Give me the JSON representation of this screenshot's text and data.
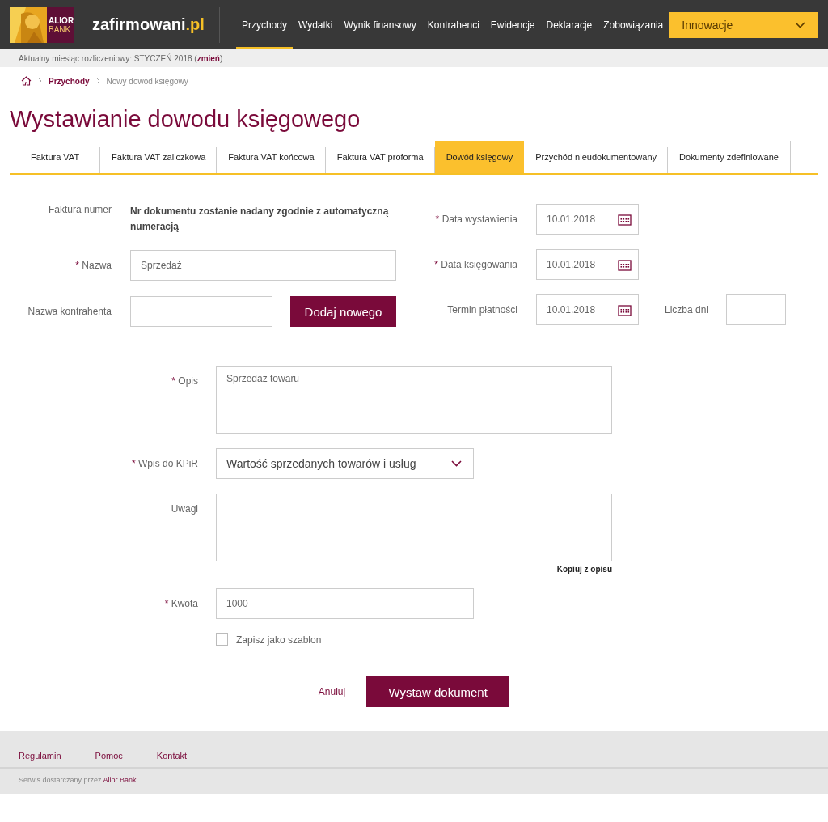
{
  "header": {
    "logo": {
      "line1": "ALIOR",
      "line2": "BANK"
    },
    "brand": {
      "name": "zafirmowani",
      "suffix": ".pl"
    },
    "nav": [
      {
        "label": "Przychody",
        "selected": true
      },
      {
        "label": "Wydatki",
        "selected": false
      },
      {
        "label": "Wynik finansowy",
        "selected": false
      },
      {
        "label": "Kontrahenci",
        "selected": false
      },
      {
        "label": "Ewidencje",
        "selected": false
      },
      {
        "label": "Deklaracje",
        "selected": false
      },
      {
        "label": "Zobowiązania",
        "selected": false
      }
    ],
    "dropdown": "Innowacje"
  },
  "period_bar": {
    "prefix": "Aktualny miesiąc rozliczeniowy: STYCZEŃ 2018 (",
    "link": "zmień",
    "suffix": ")"
  },
  "breadcrumb": [
    {
      "label": "Przychody",
      "kind": "link"
    },
    {
      "label": "Nowy dowód księgowy",
      "kind": "current"
    }
  ],
  "title": "Wystawianie dowodu księgowego",
  "tabs": [
    {
      "label": "Faktura VAT",
      "selected": false
    },
    {
      "label": "Faktura VAT zaliczkowa",
      "selected": false
    },
    {
      "label": "Faktura VAT końcowa",
      "selected": false
    },
    {
      "label": "Faktura VAT proforma",
      "selected": false
    },
    {
      "label": "Dowód księgowy",
      "selected": true
    },
    {
      "label": "Przychód nieudokumentowany",
      "selected": false
    },
    {
      "label": "Dokumenty zdefiniowane",
      "selected": false
    }
  ],
  "left_fields": [
    {
      "label": "Faktura numer",
      "kind": "info",
      "value": "Nr dokumentu zostanie nadany zgodnie z automatyczną numeracją"
    },
    {
      "label": "Nazwa",
      "mark": "*",
      "kind": "input",
      "value": "Sprzedaż"
    },
    {
      "label": "Nazwa kontrahenta",
      "kind": "input_button",
      "button": "Dodaj nowego"
    }
  ],
  "right_fields": [
    {
      "label": "Data wystawienia",
      "mark": "*",
      "value": "10.01.2018"
    },
    {
      "label": "Data księgowania",
      "mark": "*",
      "value": "10.01.2018"
    },
    {
      "label": "Termin płatności",
      "value": "10.01.2018",
      "extra_label": "Liczba dni"
    }
  ],
  "lower_fields": [
    {
      "label": "Opis",
      "mark": "*",
      "kind": "textarea",
      "value": "Sprzedaż towaru"
    },
    {
      "label": "Wpis do KPiR",
      "mark": "*",
      "kind": "select",
      "value": "Wartość sprzedanych towarów i usług"
    },
    {
      "label": "Uwagi",
      "kind": "textarea",
      "link": "Kopiuj z opisu"
    },
    {
      "label": "Kwota",
      "mark": "*",
      "kind": "input",
      "value": "1000"
    }
  ],
  "checkbox": {
    "label": "Zapisz jako szablon",
    "checked": false
  },
  "actions": {
    "cancel": "Anuluj",
    "submit": "Wystaw dokument"
  },
  "footer": {
    "links": [
      "Regulamin",
      "Pomoc",
      "Kontakt"
    ],
    "note_prefix": "Serwis dostarczany przez ",
    "note_link": "Alior Bank",
    "note_suffix": "."
  }
}
